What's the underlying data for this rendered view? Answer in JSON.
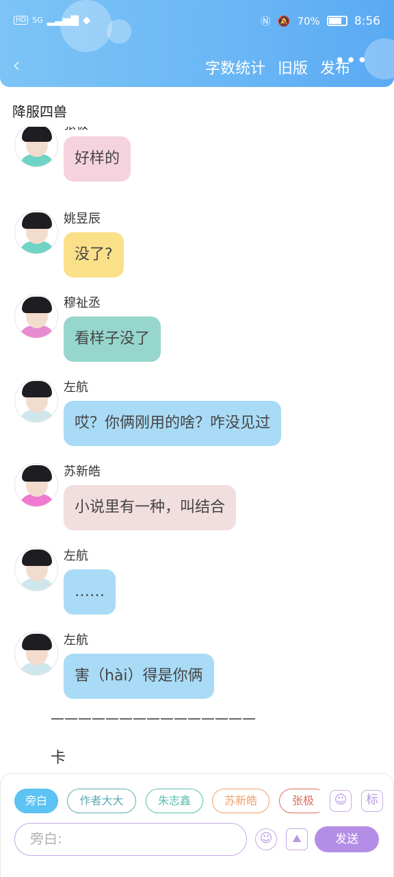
{
  "status": {
    "network": "5G",
    "battery": "70%",
    "time": "8:56"
  },
  "nav": {
    "back": "‹",
    "actions": [
      "字数统计",
      "旧版",
      "发布"
    ],
    "more": "•••"
  },
  "title": "降服四兽",
  "messages": [
    {
      "name": "张极",
      "text": "好样的",
      "bubble": "#f5d3de",
      "shirt": "#6fd3c5"
    },
    {
      "name": "姚昱辰",
      "text": "没了?",
      "bubble": "#fbe08a",
      "shirt": "#6fd3c5"
    },
    {
      "name": "穆祉丞",
      "text": "看样子没了",
      "bubble": "#96d6cc",
      "shirt": "#e88ad2"
    },
    {
      "name": "左航",
      "text": "哎？你俩刚用的啥？咋没见过",
      "bubble": "#a9dbf6",
      "shirt": "#cfe7ec"
    },
    {
      "name": "苏新皓",
      "text": "小说里有一种，叫结合",
      "bubble": "#f1dede",
      "shirt": "#f07ad0"
    },
    {
      "name": "左航",
      "text": "……",
      "bubble": "#a9dbf6",
      "shirt": "#cfe7ec"
    },
    {
      "name": "左航",
      "text": "害（hài）得是你俩",
      "bubble": "#a9dbf6",
      "shirt": "#cfe7ec"
    }
  ],
  "separator": "———————————————",
  "narration": "卡",
  "chips": [
    {
      "label": "旁白",
      "color": "#5cc3f2",
      "filled": true
    },
    {
      "label": "作者大大",
      "color": "#5aa9b4",
      "filled": false
    },
    {
      "label": "朱志鑫",
      "color": "#5bbdb0",
      "filled": false
    },
    {
      "label": "苏新皓",
      "color": "#f0a16a",
      "filled": false
    },
    {
      "label": "张极",
      "color": "#e06b5a",
      "filled": false
    }
  ],
  "icons": {
    "person": "person-icon",
    "tag": "标"
  },
  "input": {
    "placeholder": "旁白:"
  },
  "send": "发送"
}
